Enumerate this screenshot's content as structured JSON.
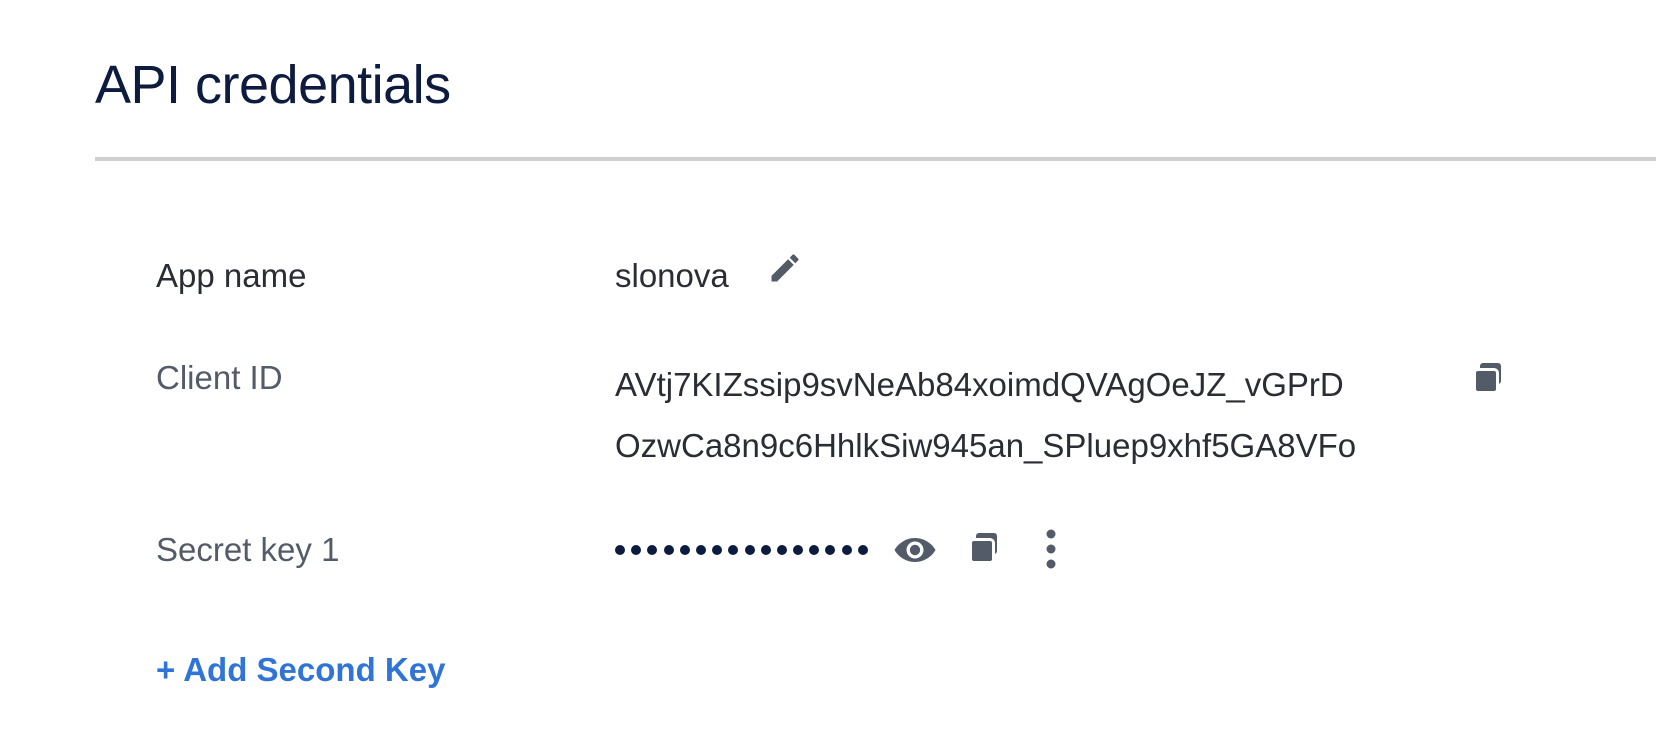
{
  "page": {
    "title": "API credentials"
  },
  "fields": {
    "app_name": {
      "label": "App name",
      "value": "slonova",
      "edit_icon": "pencil-icon"
    },
    "client_id": {
      "label": "Client ID",
      "line1": "AVtj7KIZssip9svNeAb84xoimdQVAgOeJZ_vGPrD",
      "line2": "OzwCa8n9c6HhlkSiw945an_SPluep9xhf5GA8VFo",
      "copy_icon": "copy-icon"
    },
    "secret_key": {
      "label": "Secret key 1",
      "masked_dot_count": 16,
      "show_icon": "eye-icon",
      "copy_icon": "copy-icon",
      "more_icon": "more-vertical-icon"
    }
  },
  "actions": {
    "add_second_key": "+ Add Second Key"
  },
  "colors": {
    "title": "#0d1b3e",
    "label": "#545b68",
    "value": "#2a2d33",
    "icon": "#545b68",
    "link": "#2f74d6",
    "divider": "#cfcfd1"
  }
}
